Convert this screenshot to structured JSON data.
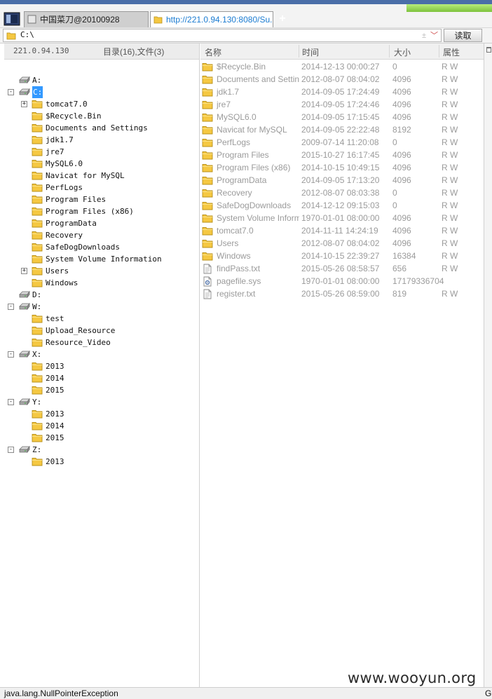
{
  "browser": {
    "tabs": [
      {
        "label": "中国菜刀@20100928",
        "active": false
      },
      {
        "label": "http://221.0.94.130:8080/Su...",
        "active": true
      }
    ],
    "new_tab_label": "+"
  },
  "address": {
    "path": "C:\\",
    "read_button": "读取"
  },
  "left_panel": {
    "host": "221.0.94.130",
    "counts": "目录(16),文件(3)",
    "tree": [
      {
        "label": "A:",
        "type": "drive",
        "expander": "",
        "level": 0
      },
      {
        "label": "C:",
        "type": "drive",
        "expander": "-",
        "level": 0,
        "selected": true
      },
      {
        "label": "tomcat7.0",
        "type": "folder",
        "expander": "+",
        "level": 1
      },
      {
        "label": "$Recycle.Bin",
        "type": "folder",
        "expander": "",
        "level": 1
      },
      {
        "label": "Documents and Settings",
        "type": "folder",
        "expander": "",
        "level": 1
      },
      {
        "label": "jdk1.7",
        "type": "folder",
        "expander": "",
        "level": 1
      },
      {
        "label": "jre7",
        "type": "folder",
        "expander": "",
        "level": 1
      },
      {
        "label": "MySQL6.0",
        "type": "folder",
        "expander": "",
        "level": 1
      },
      {
        "label": "Navicat for MySQL",
        "type": "folder",
        "expander": "",
        "level": 1
      },
      {
        "label": "PerfLogs",
        "type": "folder",
        "expander": "",
        "level": 1
      },
      {
        "label": "Program Files",
        "type": "folder",
        "expander": "",
        "level": 1
      },
      {
        "label": "Program Files (x86)",
        "type": "folder",
        "expander": "",
        "level": 1
      },
      {
        "label": "ProgramData",
        "type": "folder",
        "expander": "",
        "level": 1
      },
      {
        "label": "Recovery",
        "type": "folder",
        "expander": "",
        "level": 1
      },
      {
        "label": "SafeDogDownloads",
        "type": "folder",
        "expander": "",
        "level": 1
      },
      {
        "label": "System Volume Information",
        "type": "folder",
        "expander": "",
        "level": 1
      },
      {
        "label": "Users",
        "type": "folder",
        "expander": "+",
        "level": 1
      },
      {
        "label": "Windows",
        "type": "folder",
        "expander": "",
        "level": 1
      },
      {
        "label": "D:",
        "type": "drive",
        "expander": "",
        "level": 0
      },
      {
        "label": "W:",
        "type": "drive",
        "expander": "-",
        "level": 0
      },
      {
        "label": "test",
        "type": "folder",
        "expander": "",
        "level": 1
      },
      {
        "label": "Upload_Resource",
        "type": "folder",
        "expander": "",
        "level": 1
      },
      {
        "label": "Resource_Video",
        "type": "folder",
        "expander": "",
        "level": 1
      },
      {
        "label": "X:",
        "type": "drive",
        "expander": "-",
        "level": 0
      },
      {
        "label": "2013",
        "type": "folder",
        "expander": "",
        "level": 1
      },
      {
        "label": "2014",
        "type": "folder",
        "expander": "",
        "level": 1
      },
      {
        "label": "2015",
        "type": "folder",
        "expander": "",
        "level": 1
      },
      {
        "label": "Y:",
        "type": "drive",
        "expander": "-",
        "level": 0
      },
      {
        "label": "2013",
        "type": "folder",
        "expander": "",
        "level": 1
      },
      {
        "label": "2014",
        "type": "folder",
        "expander": "",
        "level": 1
      },
      {
        "label": "2015",
        "type": "folder",
        "expander": "",
        "level": 1
      },
      {
        "label": "Z:",
        "type": "drive",
        "expander": "-",
        "level": 0
      },
      {
        "label": "2013",
        "type": "folder",
        "expander": "",
        "level": 1
      }
    ]
  },
  "file_list": {
    "columns": [
      "名称",
      "时间",
      "大小",
      "属性"
    ],
    "rows": [
      {
        "name": "$Recycle.Bin",
        "time": "2014-12-13 00:00:27",
        "size": "0",
        "attr": "R W",
        "icon": "folder"
      },
      {
        "name": "Documents and Settings",
        "time": "2012-08-07 08:04:02",
        "size": "4096",
        "attr": "R W",
        "icon": "folder"
      },
      {
        "name": "jdk1.7",
        "time": "2014-09-05 17:24:49",
        "size": "4096",
        "attr": "R W",
        "icon": "folder"
      },
      {
        "name": "jre7",
        "time": "2014-09-05 17:24:46",
        "size": "4096",
        "attr": "R W",
        "icon": "folder"
      },
      {
        "name": "MySQL6.0",
        "time": "2014-09-05 17:15:45",
        "size": "4096",
        "attr": "R W",
        "icon": "folder"
      },
      {
        "name": "Navicat for MySQL",
        "time": "2014-09-05 22:22:48",
        "size": "8192",
        "attr": "R W",
        "icon": "folder"
      },
      {
        "name": "PerfLogs",
        "time": "2009-07-14 11:20:08",
        "size": "0",
        "attr": "R W",
        "icon": "folder"
      },
      {
        "name": "Program Files",
        "time": "2015-10-27 16:17:45",
        "size": "4096",
        "attr": "R W",
        "icon": "folder"
      },
      {
        "name": "Program Files (x86)",
        "time": "2014-10-15 10:49:15",
        "size": "4096",
        "attr": "R W",
        "icon": "folder"
      },
      {
        "name": "ProgramData",
        "time": "2014-09-05 17:13:20",
        "size": "4096",
        "attr": "R W",
        "icon": "folder"
      },
      {
        "name": "Recovery",
        "time": "2012-08-07 08:03:38",
        "size": "0",
        "attr": "R W",
        "icon": "folder"
      },
      {
        "name": "SafeDogDownloads",
        "time": "2014-12-12 09:15:03",
        "size": "0",
        "attr": "R W",
        "icon": "folder"
      },
      {
        "name": "System Volume Inform...",
        "time": "1970-01-01 08:00:00",
        "size": "4096",
        "attr": "R W",
        "icon": "folder"
      },
      {
        "name": "tomcat7.0",
        "time": "2014-11-11 14:24:19",
        "size": "4096",
        "attr": "R W",
        "icon": "folder"
      },
      {
        "name": "Users",
        "time": "2012-08-07 08:04:02",
        "size": "4096",
        "attr": "R W",
        "icon": "folder"
      },
      {
        "name": "Windows",
        "time": "2014-10-15 22:39:27",
        "size": "16384",
        "attr": "R W",
        "icon": "folder"
      },
      {
        "name": "findPass.txt",
        "time": "2015-05-26 08:58:57",
        "size": "656",
        "attr": "R W",
        "icon": "file"
      },
      {
        "name": "pagefile.sys",
        "time": "1970-01-01 08:00:00",
        "size": "17179336704",
        "attr": "",
        "icon": "sysfile"
      },
      {
        "name": "register.txt",
        "time": "2015-05-26 08:59:00",
        "size": "819",
        "attr": "R W",
        "icon": "file"
      }
    ]
  },
  "status": {
    "message": "java.lang.NullPointerException",
    "right": "G"
  },
  "watermark": "www.wooyun.org",
  "colors": {
    "selection": "#3399ff",
    "folder": "#f5c842",
    "tab_url": "#1a7bd1",
    "muted_text": "#9b9b9b"
  }
}
